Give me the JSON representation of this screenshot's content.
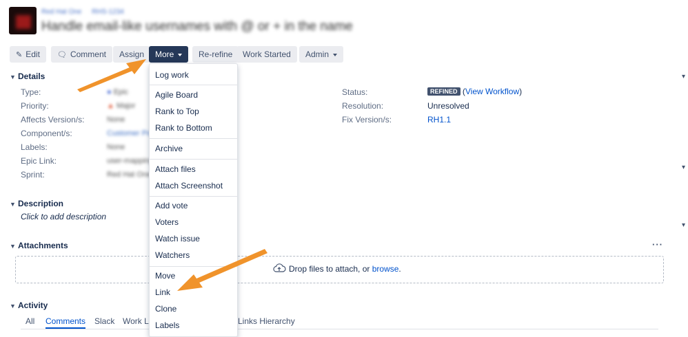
{
  "header": {
    "breadcrumb": [
      "Red Hat One",
      "RHS-1234"
    ],
    "title": "Handle email-like usernames with @ or + in the name"
  },
  "toolbar": {
    "edit": "Edit",
    "comment": "Comment",
    "assign": "Assign",
    "more": "More",
    "rerefine": "Re-refine",
    "work_started": "Work Started",
    "admin": "Admin"
  },
  "details": {
    "heading": "Details",
    "left": [
      {
        "label": "Type:",
        "value": "Epic"
      },
      {
        "label": "Priority:",
        "value": "Major"
      },
      {
        "label": "Affects Version/s:",
        "value": "None"
      },
      {
        "label": "Component/s:",
        "value": "Customer Portal"
      },
      {
        "label": "Labels:",
        "value": "None"
      },
      {
        "label": "Epic Link:",
        "value": "user-mapping"
      },
      {
        "label": "Sprint:",
        "value": "Red Hat One Sprint"
      }
    ],
    "status_label": "Status:",
    "status_badge": "REFINED",
    "view_workflow": "View Workflow",
    "resolution_label": "Resolution:",
    "resolution_value": "Unresolved",
    "fix_label": "Fix Version/s:",
    "fix_value": "RH1.1"
  },
  "description": {
    "heading": "Description",
    "placeholder": "Click to add description"
  },
  "attachments": {
    "heading": "Attachments",
    "more": "···",
    "drop_text": "Drop files to attach, or ",
    "browse": "browse",
    "period": "."
  },
  "activity": {
    "heading": "Activity",
    "tabs": [
      "All",
      "Comments",
      "Slack",
      "Work Log",
      "Links Hierarchy"
    ],
    "selected_tab": "Comments"
  },
  "more_menu": {
    "groups": [
      [
        "Log work"
      ],
      [
        "Agile Board",
        "Rank to Top",
        "Rank to Bottom"
      ],
      [
        "Archive"
      ],
      [
        "Attach files",
        "Attach Screenshot"
      ],
      [
        "Add vote",
        "Voters",
        "Watch issue",
        "Watchers"
      ],
      [
        "Move",
        "Link",
        "Clone",
        "Labels"
      ]
    ]
  },
  "colors": {
    "annotation_arrow": "#f0932b",
    "active_button": "#253858",
    "link": "#0052cc"
  }
}
